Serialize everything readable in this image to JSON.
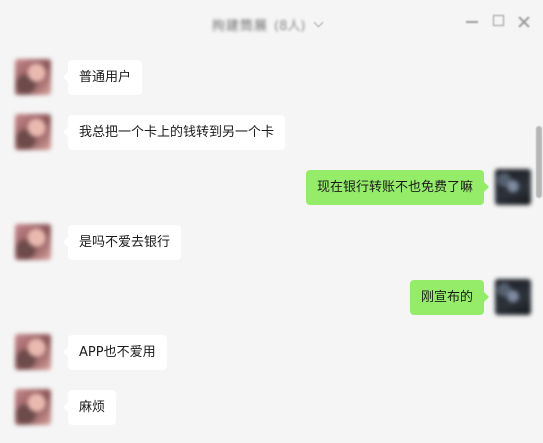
{
  "window": {
    "title": "拘建筒展",
    "member_count": "(8人)"
  },
  "messages": [
    {
      "side": "left",
      "text": "普通用户"
    },
    {
      "side": "left",
      "text": "我总把一个卡上的钱转到另一个卡"
    },
    {
      "side": "right",
      "text": "现在银行转账不也免费了嘛"
    },
    {
      "side": "left",
      "text": "是吗不爱去银行"
    },
    {
      "side": "right",
      "text": "刚宣布的"
    },
    {
      "side": "left",
      "text": "APP也不爱用"
    },
    {
      "side": "left",
      "text": "麻烦"
    }
  ],
  "colors": {
    "background": "#f5f5f5",
    "incoming_bubble": "#ffffff",
    "outgoing_bubble": "#95ec69"
  }
}
